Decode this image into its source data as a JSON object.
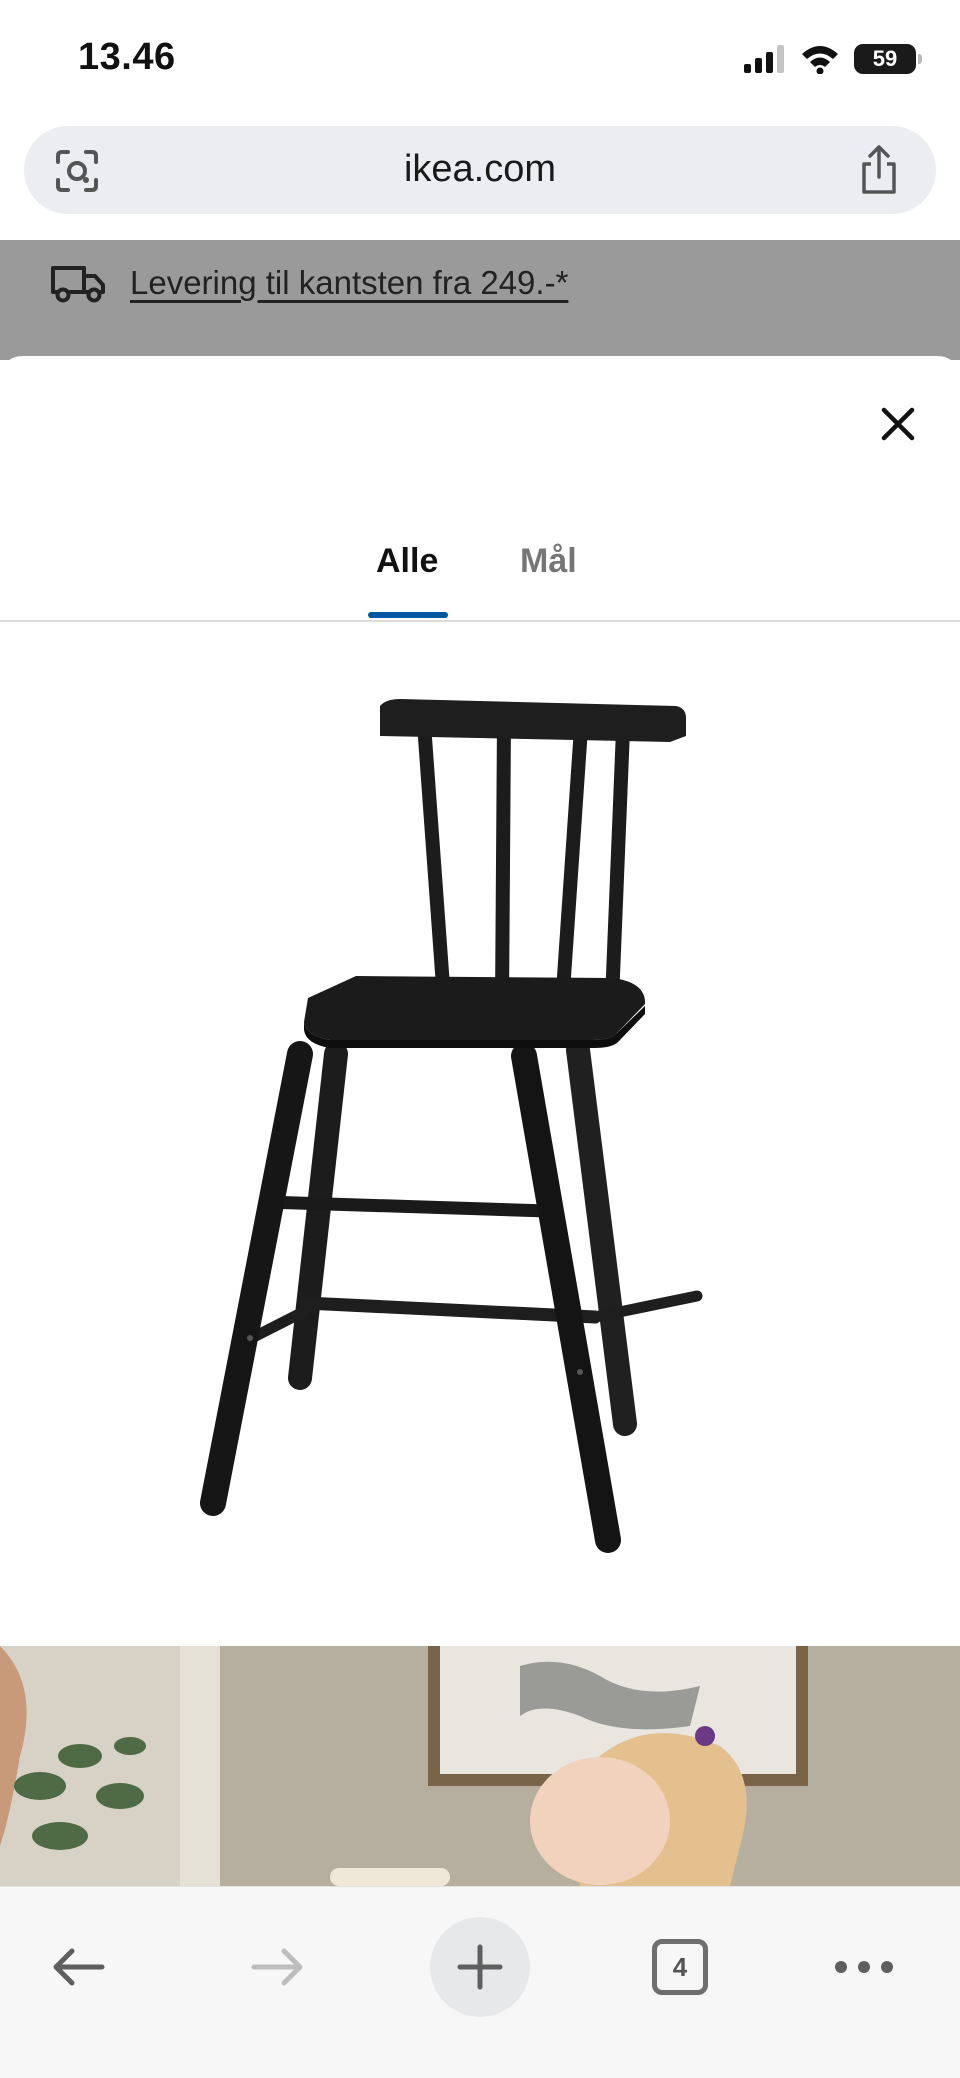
{
  "status_bar": {
    "time": "13.46",
    "battery": "59"
  },
  "browser": {
    "url": "ikea.com",
    "tabs_count": "4"
  },
  "background_page": {
    "delivery_text": "Levering til kantsten fra 249.-*"
  },
  "sheet": {
    "tabs": [
      {
        "label": "Alle",
        "selected": true
      },
      {
        "label": "Mål",
        "selected": false
      }
    ],
    "accent_color": "#0058a3"
  },
  "icons": [
    "signal-icon",
    "wifi-icon",
    "battery-icon",
    "lens-icon",
    "share-icon",
    "truck-icon",
    "close-icon",
    "back-arrow-icon",
    "forward-arrow-icon",
    "plus-icon",
    "tabs-icon",
    "more-icon"
  ]
}
